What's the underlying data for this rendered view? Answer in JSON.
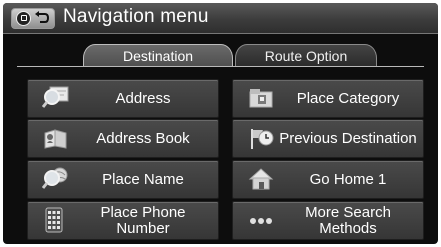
{
  "header": {
    "title": "Navigation menu",
    "back_icon": "back-arrow-icon"
  },
  "tabs": [
    {
      "label": "Destination",
      "active": true
    },
    {
      "label": "Route Option",
      "active": false
    }
  ],
  "menu": {
    "address": {
      "label": "Address",
      "icon": "magnifier-map-icon"
    },
    "place_category": {
      "label": "Place Category",
      "icon": "folder-icon"
    },
    "address_book": {
      "label": "Address Book",
      "icon": "address-book-icon"
    },
    "previous_destination": {
      "label": "Previous Destination",
      "icon": "flag-clock-icon"
    },
    "place_name": {
      "label": "Place Name",
      "icon": "magnifier-globe-icon"
    },
    "go_home": {
      "label": "Go Home 1",
      "icon": "home-icon"
    },
    "place_phone": {
      "label": "Place Phone Number",
      "icon": "keypad-icon"
    },
    "more_search": {
      "label": "More Search Methods",
      "icon": "more-dots-icon"
    }
  },
  "colors": {
    "background": "#0d0d0d",
    "button": "#404040",
    "text": "#ffffff"
  }
}
